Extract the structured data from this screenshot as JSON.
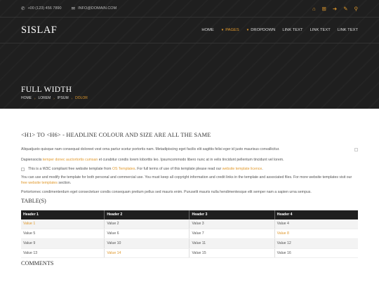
{
  "topbar": {
    "phone_icon": "phone-icon",
    "phone": "+00 (123) 456 7890",
    "email_icon": "envelope-icon",
    "email": "INFO@DOMAIN.COM",
    "social": [
      {
        "icon": "home-icon",
        "glyph": "⌂"
      },
      {
        "icon": "sitemap-icon",
        "glyph": "⊞"
      },
      {
        "icon": "login-icon",
        "glyph": "➜"
      },
      {
        "icon": "edit-icon",
        "glyph": "✎"
      },
      {
        "icon": "search-icon",
        "glyph": "⚲"
      }
    ]
  },
  "header": {
    "logo": "SISLAF",
    "nav": {
      "home": "HOME",
      "pages": "PAGES",
      "dropdown": "DROPDOWN",
      "link1": "LINK TEXT",
      "link2": "LINK TEXT",
      "link3": "LINK TEXT"
    }
  },
  "page": {
    "title": "FULL WIDTH",
    "breadcrumb": [
      "HOME",
      "LOREM",
      "IPSUM",
      "DOLOR"
    ]
  },
  "content": {
    "headline": "<H1> TO <H6> - HEADLINE COLOUR AND SIZE ARE ALL THE SAME",
    "p1": "Aliquatjusto quisque nam consequat doloreet vest orna partur scetur portortis nam. Metadipiscing eget facilis elit sagittis felisi eger id justo maurisus convallicitur.",
    "p2_a": "Dapiensociis ",
    "p2_link": "temper donec auctortortis cumsan",
    "p2_b": " et curabitur condis lorem loborttis leo. Ipsumcommodo libero nunc at in velis tincidunt pellentum tincidunt vel lorem.",
    "p3_a": "This is a W3C compliant free website template from ",
    "p3_link1": "OS Templates",
    "p3_b": ". For full terms of use of this template please read our ",
    "p3_link2": "website template licence",
    "p3_c": ".",
    "p4_a": "You can use and modify the template for both personal and commercial use. You must keep all copyright information and credit links in the template and associated files. For more website templates visit our ",
    "p4_link": "free website templates",
    "p4_b": " section.",
    "p5": "Portortornec condimenterdum eget consectetuer condis consequam pretium pellus sed mauris enim. Puruselit mauris nulla hendimentesque elit semper nam a sapien urna sempus.",
    "tables_title": "TABLE(S)",
    "comments_title": "COMMENTS"
  },
  "table": {
    "headers": [
      "Header 1",
      "Header 2",
      "Header 3",
      "Header 4"
    ],
    "rows": [
      [
        "Value 1",
        "Value 2",
        "Value 3",
        "Value 4"
      ],
      [
        "Value 5",
        "Value 6",
        "Value 7",
        "Value 8"
      ],
      [
        "Value 9",
        "Value 10",
        "Value 11",
        "Value 12"
      ],
      [
        "Value 13",
        "Value 14",
        "Value 15",
        "Value 16"
      ]
    ],
    "links": [
      "Value 1",
      "Value 8",
      "Value 14"
    ]
  },
  "colors": {
    "accent": "#e0992d",
    "dark": "#1f1f1f"
  }
}
